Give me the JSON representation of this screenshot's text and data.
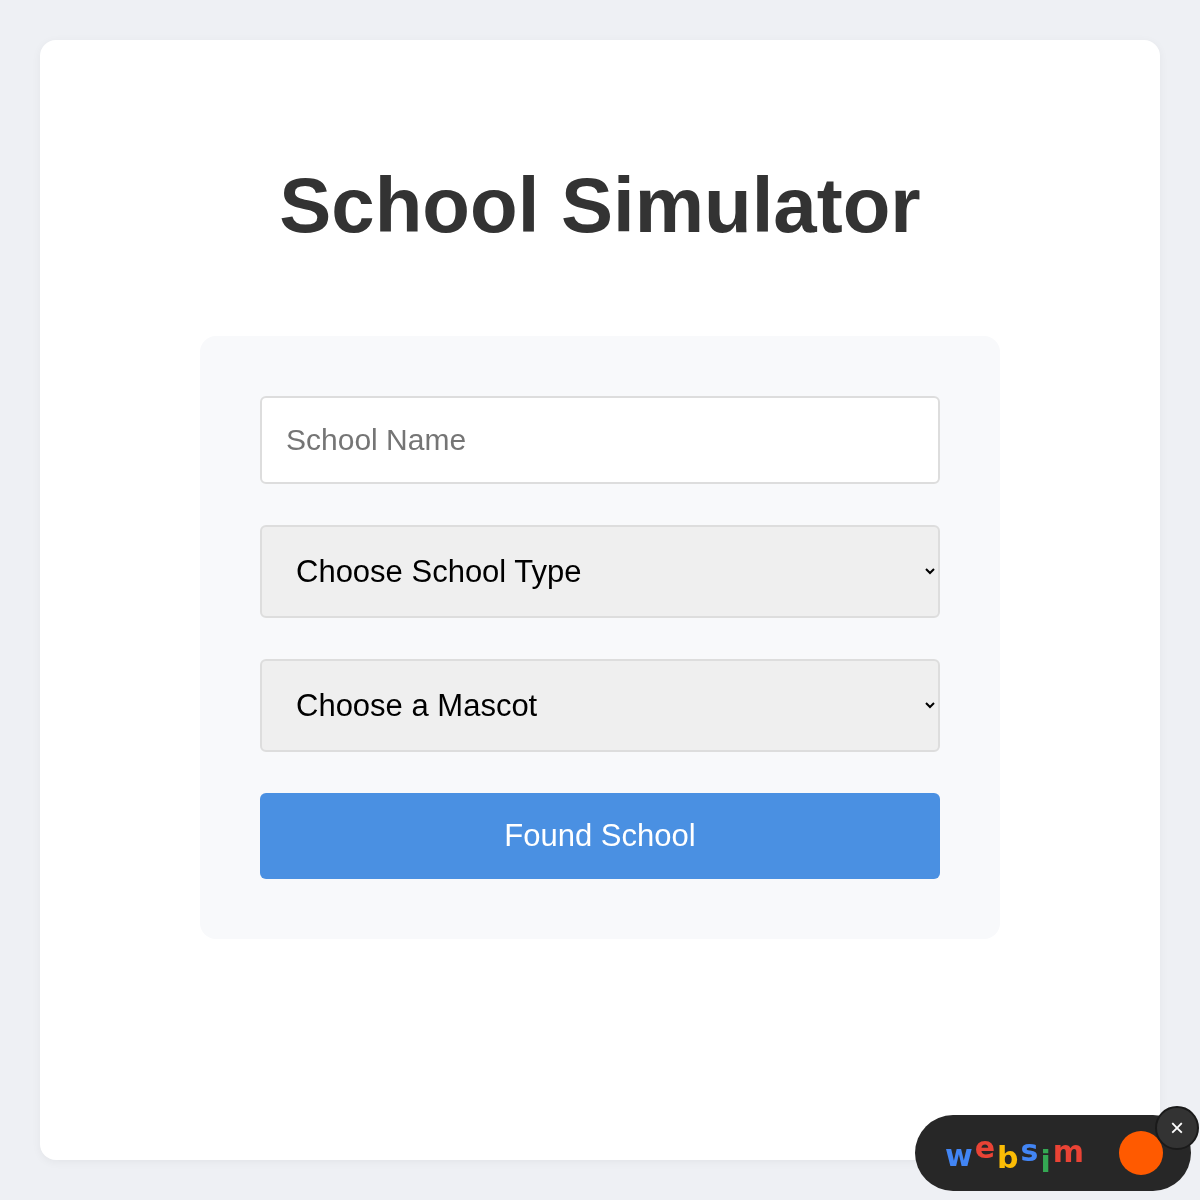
{
  "title": "School Simulator",
  "form": {
    "name_field": {
      "placeholder": "School Name"
    },
    "selects": [
      {
        "value": "Choose School Type"
      },
      {
        "value": "Choose a Mascot"
      }
    ],
    "submit_button": "Found School"
  },
  "badge": {
    "letters": [
      {
        "text": "w",
        "color": "#4285f4"
      },
      {
        "text": "e",
        "color": "#ea4335"
      },
      {
        "text": "b",
        "color": "#fbbc05"
      },
      {
        "text": "s",
        "color": "#4285f4"
      },
      {
        "text": "i",
        "color": "#34a853"
      },
      {
        "text": "m",
        "color": "#ea4335"
      }
    ],
    "close": "×"
  }
}
